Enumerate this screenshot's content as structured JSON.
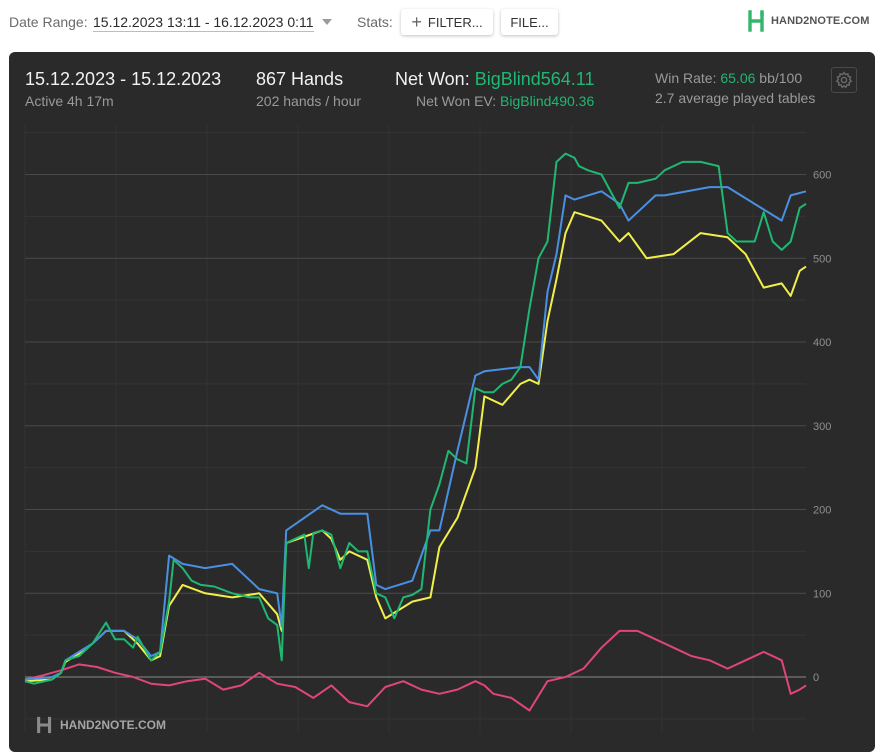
{
  "toolbar": {
    "date_range_label": "Date Range:",
    "date_range_value": "15.12.2023 13:11 - 16.12.2023 0:11",
    "stats_label": "Stats:",
    "filter_button": "FILTER...",
    "file_button": "FILE...",
    "brand": "HAND2NOTE.COM"
  },
  "summary": {
    "date_range": "15.12.2023 - 15.12.2023",
    "active": "Active 4h 17m",
    "hands": "867 Hands",
    "hands_per_hour": "202 hands / hour",
    "net_won_label": "Net Won:",
    "net_won_value": "BigBlind564.11",
    "net_won_ev_label": "Net Won  EV:",
    "net_won_ev_value": "BigBlind490.36",
    "win_rate_label": "Win Rate:",
    "win_rate_value": "65.06",
    "win_rate_unit": "bb/100",
    "tables": "2.7 average played tables"
  },
  "watermark": "HAND2NOTE.COM",
  "colors": {
    "net_won": "#1fb873",
    "ev": "#4a90e2",
    "showdown": "#f1f04a",
    "non_showdown": "#e0457b",
    "panel_bg": "#2a2a2a"
  },
  "icons": [
    "plus-icon",
    "hand2note-logo-icon",
    "gear-icon"
  ],
  "chart_data": {
    "type": "line",
    "ylim": [
      -50,
      650
    ],
    "y_ticks": [
      0,
      100,
      200,
      300,
      400,
      500,
      600
    ],
    "x_range": [
      0,
      867
    ],
    "grid": "on",
    "series": [
      {
        "key": "netwon",
        "x": [
          0,
          10,
          30,
          40,
          45,
          60,
          75,
          90,
          100,
          110,
          120,
          125,
          140,
          150,
          160,
          165,
          175,
          185,
          195,
          210,
          230,
          250,
          260,
          270,
          280,
          285,
          290,
          300,
          310,
          315,
          320,
          330,
          340,
          350,
          360,
          370,
          380,
          390,
          400,
          410,
          420,
          430,
          440,
          450,
          460,
          470,
          480,
          490,
          500,
          510,
          520,
          530,
          540,
          550,
          560,
          570,
          580,
          590,
          600,
          610,
          615,
          625,
          640,
          660,
          670,
          680,
          700,
          710,
          730,
          750,
          770,
          780,
          790,
          800,
          810,
          820,
          830,
          840,
          850,
          860,
          867
        ],
        "y": [
          -5,
          -8,
          -3,
          5,
          20,
          25,
          40,
          65,
          45,
          45,
          35,
          48,
          20,
          30,
          90,
          140,
          130,
          115,
          110,
          108,
          100,
          95,
          95,
          70,
          62,
          20,
          160,
          165,
          170,
          130,
          172,
          175,
          170,
          130,
          160,
          150,
          150,
          100,
          95,
          70,
          95,
          98,
          105,
          200,
          230,
          270,
          260,
          255,
          345,
          340,
          340,
          350,
          355,
          370,
          440,
          500,
          520,
          615,
          625,
          620,
          610,
          605,
          600,
          560,
          590,
          590,
          595,
          605,
          615,
          615,
          610,
          530,
          520,
          520,
          520,
          555,
          520,
          510,
          520,
          560,
          565
        ]
      },
      {
        "key": "ev",
        "x": [
          0,
          30,
          40,
          45,
          60,
          75,
          90,
          110,
          125,
          140,
          150,
          160,
          175,
          200,
          230,
          260,
          280,
          285,
          290,
          330,
          350,
          380,
          390,
          400,
          430,
          450,
          460,
          480,
          500,
          510,
          550,
          560,
          570,
          580,
          590,
          600,
          610,
          640,
          660,
          670,
          700,
          710,
          760,
          780,
          840,
          850,
          867
        ],
        "y": [
          -3,
          0,
          5,
          20,
          30,
          40,
          55,
          55,
          45,
          25,
          30,
          145,
          135,
          130,
          135,
          105,
          100,
          60,
          175,
          205,
          195,
          195,
          110,
          105,
          115,
          175,
          175,
          270,
          360,
          365,
          370,
          370,
          355,
          460,
          505,
          575,
          570,
          580,
          565,
          545,
          575,
          575,
          585,
          585,
          545,
          575,
          580
        ]
      },
      {
        "key": "showdown",
        "x": [
          0,
          30,
          40,
          45,
          60,
          75,
          90,
          110,
          125,
          140,
          150,
          160,
          175,
          200,
          230,
          260,
          280,
          285,
          290,
          330,
          340,
          350,
          360,
          380,
          390,
          400,
          430,
          450,
          460,
          480,
          500,
          510,
          530,
          550,
          560,
          570,
          580,
          590,
          600,
          610,
          640,
          660,
          670,
          690,
          720,
          750,
          780,
          800,
          820,
          840,
          850,
          860,
          867
        ],
        "y": [
          -5,
          -3,
          5,
          18,
          28,
          40,
          55,
          55,
          40,
          20,
          25,
          85,
          110,
          100,
          95,
          100,
          75,
          55,
          160,
          175,
          165,
          140,
          150,
          140,
          95,
          70,
          90,
          95,
          155,
          190,
          250,
          335,
          325,
          350,
          355,
          350,
          425,
          475,
          530,
          555,
          545,
          520,
          530,
          500,
          505,
          530,
          525,
          505,
          465,
          470,
          455,
          485,
          490
        ]
      },
      {
        "key": "nonshowdown",
        "x": [
          0,
          20,
          40,
          60,
          80,
          100,
          120,
          140,
          160,
          180,
          200,
          220,
          240,
          260,
          280,
          300,
          320,
          340,
          360,
          380,
          400,
          420,
          440,
          460,
          480,
          500,
          510,
          520,
          540,
          560,
          580,
          600,
          620,
          640,
          660,
          680,
          700,
          720,
          740,
          760,
          780,
          800,
          820,
          840,
          850,
          860,
          867
        ],
        "y": [
          -3,
          2,
          8,
          15,
          12,
          5,
          0,
          -8,
          -10,
          -5,
          -2,
          -15,
          -10,
          5,
          -8,
          -12,
          -25,
          -10,
          -30,
          -35,
          -12,
          -5,
          -15,
          -20,
          -15,
          -5,
          -10,
          -20,
          -25,
          -40,
          -5,
          0,
          10,
          35,
          55,
          55,
          45,
          35,
          25,
          20,
          10,
          20,
          30,
          20,
          -20,
          -15,
          -10
        ]
      }
    ]
  }
}
